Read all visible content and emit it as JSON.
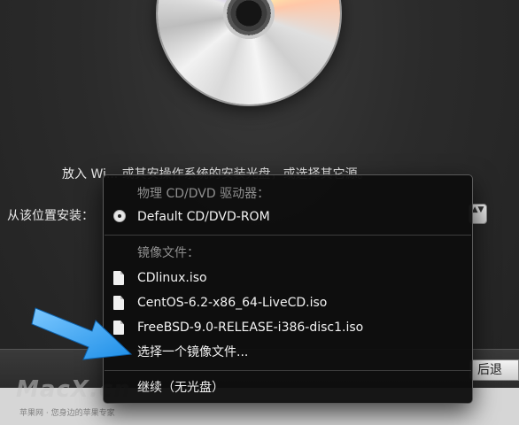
{
  "instruction_text": "放入 Wi... 或其安操作系统的安装光盘，或选择其它源。",
  "location_label": "从该位置安装：",
  "stepper_glyph": "▲▼",
  "back_button": "后退",
  "watermark": {
    "logo": "MacX.cn",
    "subtitle": "苹果网 · 您身边的苹果专家"
  },
  "menu": {
    "section_drives": "物理 CD/DVD 驱动器：",
    "drive_items": [
      {
        "label": "Default CD/DVD-ROM",
        "icon": "disc-icon",
        "selected": true
      }
    ],
    "section_images": "镜像文件：",
    "image_items": [
      {
        "label": "CDlinux.iso",
        "icon": "file-icon"
      },
      {
        "label": "CentOS-6.2-x86_64-LiveCD.iso",
        "icon": "file-icon"
      },
      {
        "label": "FreeBSD-9.0-RELEASE-i386-disc1.iso",
        "icon": "file-icon"
      }
    ],
    "choose_image": "选择一个镜像文件...",
    "continue_no_disc": "继续（无光盘）"
  },
  "colors": {
    "menu_bg": "#0e0e0e",
    "section_header": "#8f8f8f",
    "arrow": "#2aa6ff"
  }
}
